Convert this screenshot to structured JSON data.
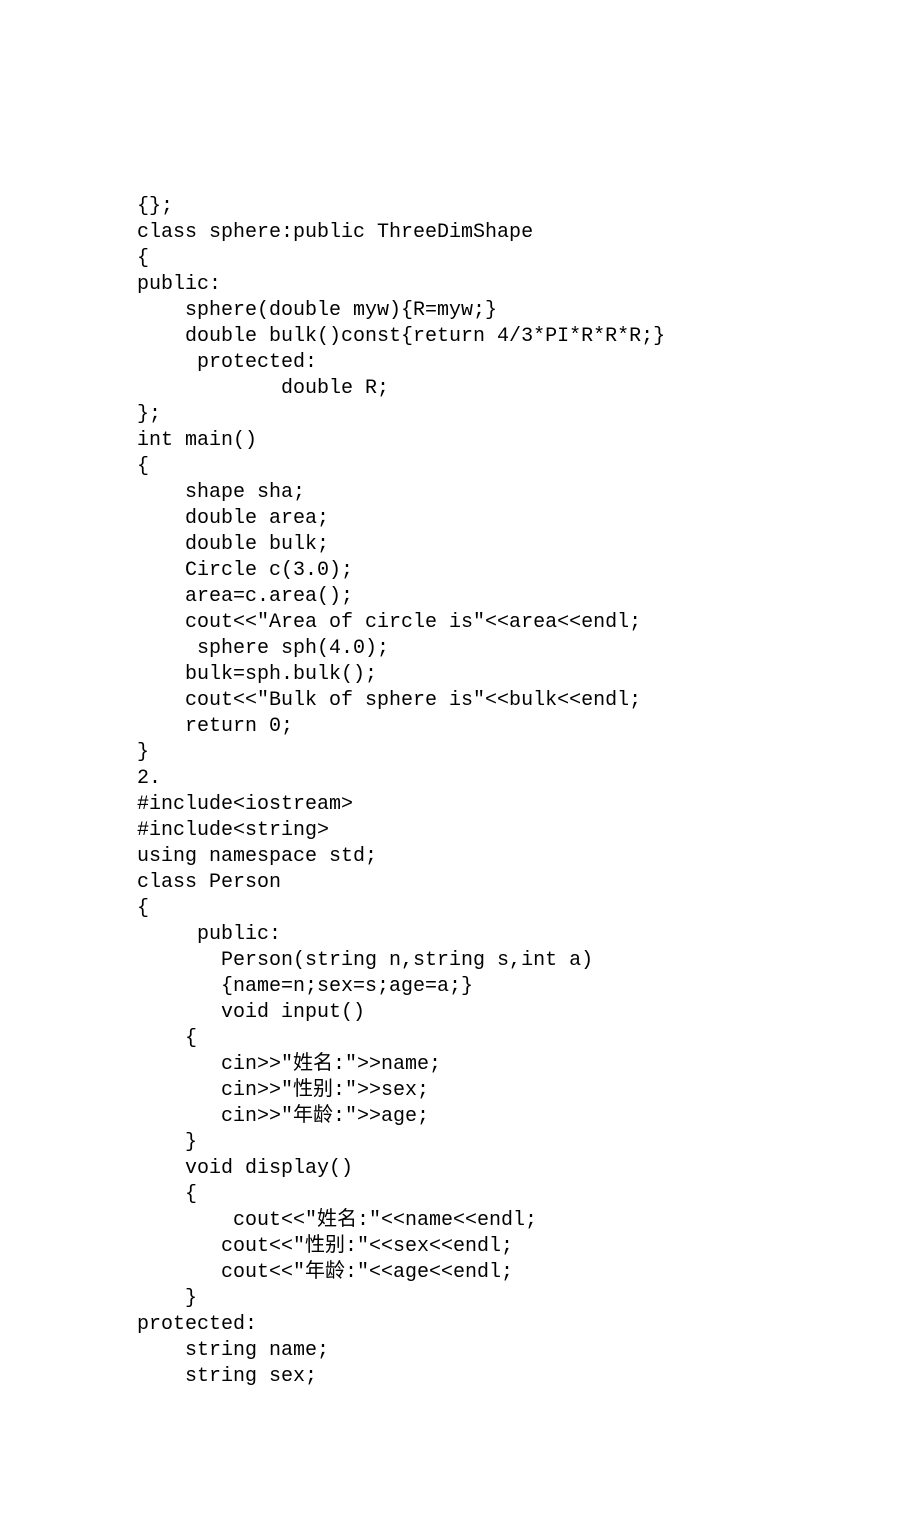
{
  "code": {
    "lines": [
      "{};",
      "class sphere:public ThreeDimShape",
      "{",
      "public:",
      "    sphere(double myw){R=myw;}",
      "    double bulk()const{return 4/3*PI*R*R*R;}",
      "     protected:",
      "            double R;",
      "};",
      "int main()",
      "{",
      "    shape sha;",
      "    double area;",
      "    double bulk;",
      "    Circle c(3.0);",
      "    area=c.area();",
      "    cout<<\"Area of circle is\"<<area<<endl;",
      "     sphere sph(4.0);",
      "    bulk=sph.bulk();",
      "    cout<<\"Bulk of sphere is\"<<bulk<<endl;",
      "    return 0;",
      "}",
      "2.",
      "#include<iostream>",
      "#include<string>",
      "using namespace std;",
      "class Person",
      "{",
      "     public:",
      "       Person(string n,string s,int a)",
      "       {name=n;sex=s;age=a;}",
      "       void input()",
      "    {",
      "       cin>>\"姓名:\">>name;",
      "       cin>>\"性别:\">>sex;",
      "       cin>>\"年龄:\">>age;",
      "    }",
      "    void display()",
      "    {",
      "        cout<<\"姓名:\"<<name<<endl;",
      "       cout<<\"性别:\"<<sex<<endl;",
      "       cout<<\"年龄:\"<<age<<endl;",
      "    }",
      "protected:",
      "    string name;",
      "    string sex;"
    ]
  }
}
